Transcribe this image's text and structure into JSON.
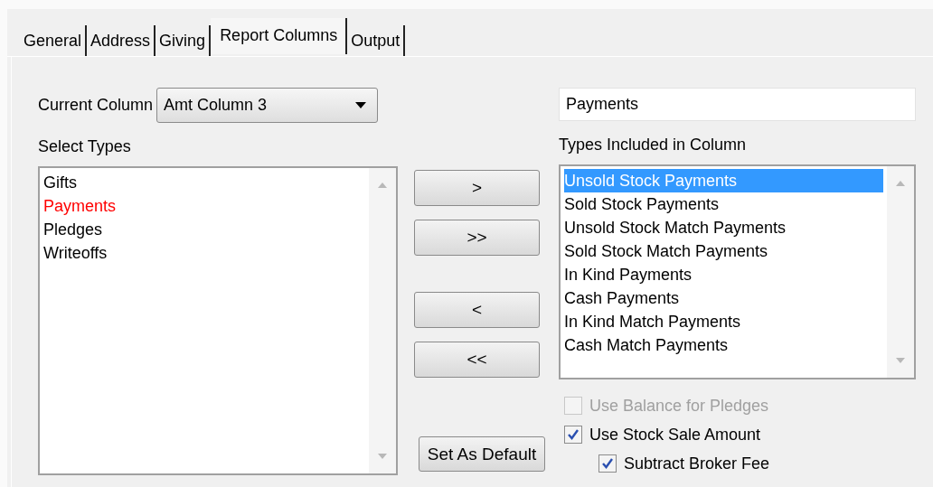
{
  "tabs": [
    {
      "label": "General",
      "selected": false
    },
    {
      "label": "Address",
      "selected": false
    },
    {
      "label": "Giving",
      "selected": false
    },
    {
      "label": "Report Columns",
      "selected": true
    },
    {
      "label": "Output",
      "selected": false
    }
  ],
  "current_column": {
    "label": "Current Column",
    "value": "Amt Column 3"
  },
  "select_types": {
    "label": "Select Types",
    "items": [
      {
        "label": "Gifts",
        "color": "#000000"
      },
      {
        "label": "Payments",
        "color": "#ff0000"
      },
      {
        "label": "Pledges",
        "color": "#000000"
      },
      {
        "label": "Writeoffs",
        "color": "#000000"
      }
    ]
  },
  "move_buttons": [
    ">",
    ">>",
    "<",
    "<<"
  ],
  "default_button": "Set As Default",
  "column_name": {
    "value": "Payments"
  },
  "included_types": {
    "label": "Types Included in Column",
    "items": [
      {
        "label": "Unsold Stock Payments",
        "selected": true
      },
      {
        "label": "Sold Stock Payments",
        "selected": false
      },
      {
        "label": "Unsold Stock Match Payments",
        "selected": false
      },
      {
        "label": "Sold Stock Match Payments",
        "selected": false
      },
      {
        "label": "In Kind Payments",
        "selected": false
      },
      {
        "label": "Cash Payments",
        "selected": false
      },
      {
        "label": "In Kind Match Payments",
        "selected": false
      },
      {
        "label": "Cash Match Payments",
        "selected": false
      }
    ]
  },
  "options": [
    {
      "label": "Use Balance for Pledges",
      "checked": false,
      "disabled": true
    },
    {
      "label": "Use Stock Sale Amount",
      "checked": true,
      "disabled": false,
      "children": [
        {
          "label": "Subtract Broker Fee",
          "checked": true,
          "disabled": false
        }
      ]
    }
  ]
}
